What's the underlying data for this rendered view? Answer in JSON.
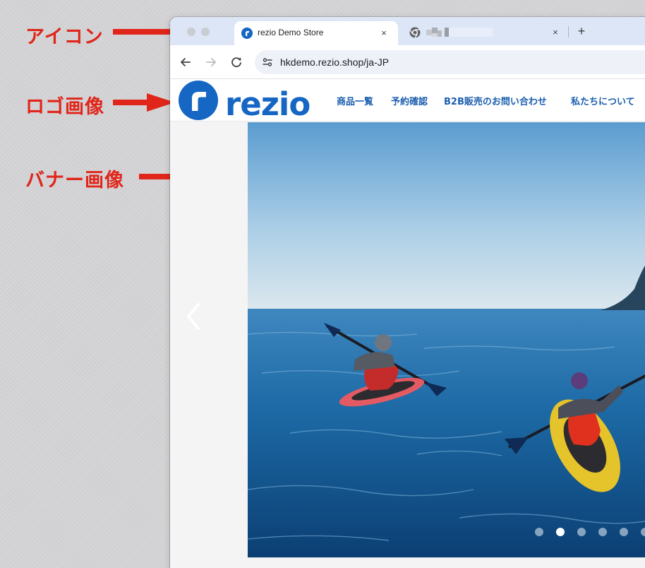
{
  "annotations": {
    "icon_label": "アイコン",
    "logo_label": "ロゴ画像",
    "banner_label": "バナー画像"
  },
  "browser": {
    "active_tab": {
      "title": "rezio Demo Store",
      "close": "×"
    },
    "inactive_tab": {
      "close": "×"
    },
    "new_tab": "+",
    "url": "hkdemo.rezio.shop/ja-JP"
  },
  "site": {
    "logo_text": "rezio",
    "nav": [
      "商品一覧",
      "予約確認",
      "B2B販売のお問い合わせ",
      "私たちについて"
    ]
  },
  "carousel": {
    "slide_count": 6,
    "active_index": 1
  },
  "colors": {
    "annotation": "#e0261b",
    "brand_blue": "#1666c3",
    "nav_text": "#1c5fb0"
  }
}
